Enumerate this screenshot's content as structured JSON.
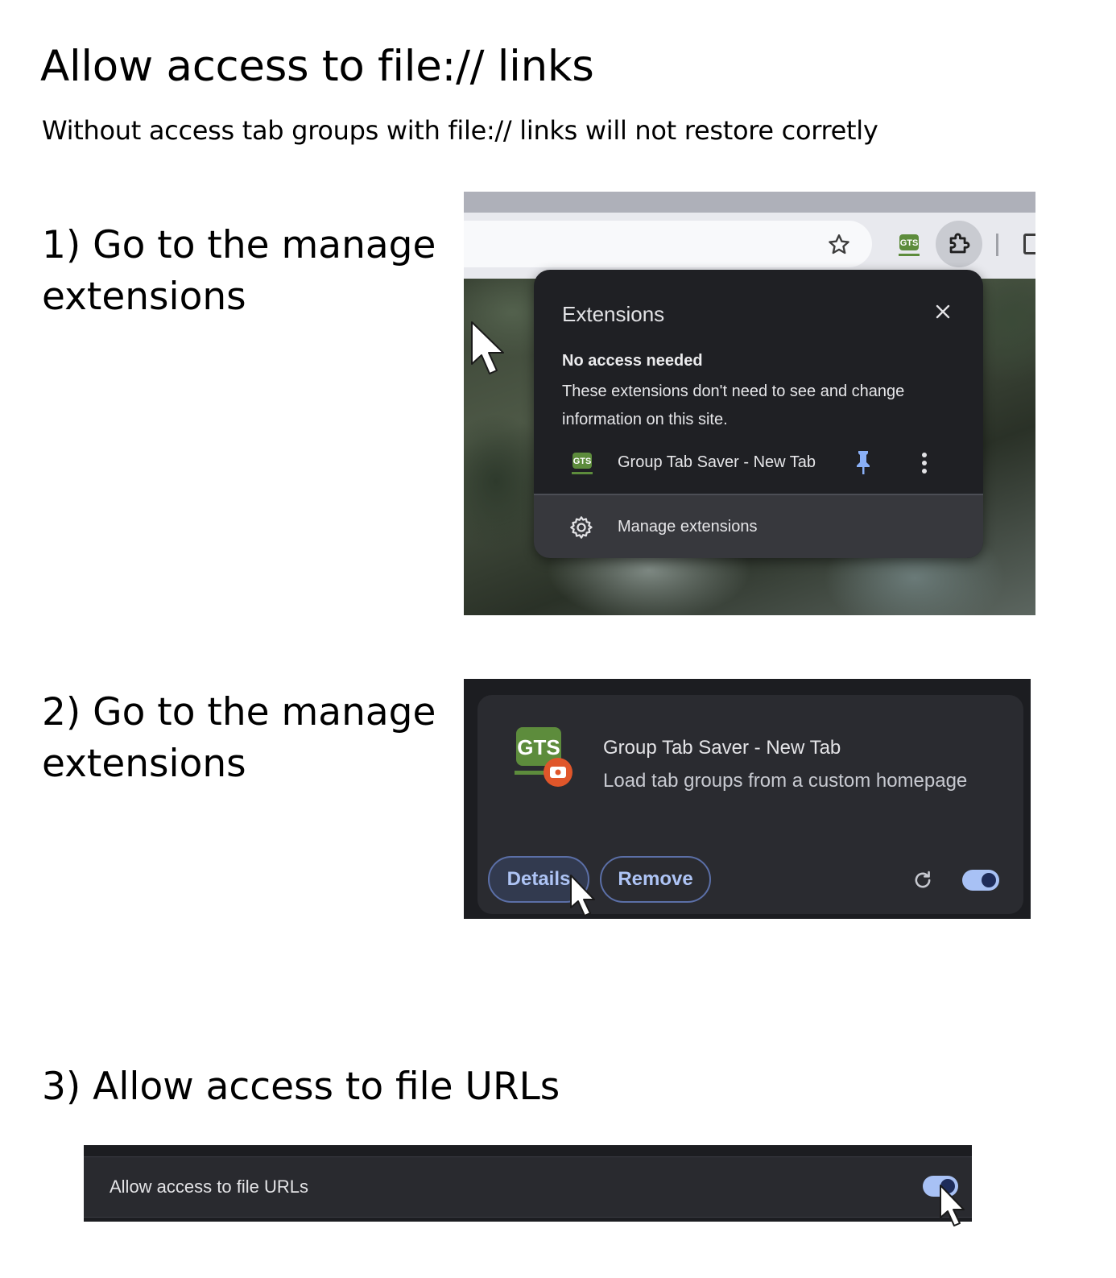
{
  "doc": {
    "title": "Allow access to file:// links",
    "subtitle": "Without access tab groups with file:// links will not restore corretly"
  },
  "steps": [
    {
      "label": "1) Go to the manage extensions"
    },
    {
      "label": "2) Go to the manage extensions"
    },
    {
      "label": "3) Allow access to file URLs"
    }
  ],
  "extensions_popup": {
    "title": "Extensions",
    "section_title": "No access needed",
    "section_description": "These extensions don't need to see and change information on this site.",
    "extension_name": "Group Tab Saver - New Tab",
    "manage_label": "Manage extensions",
    "icons": [
      "star-icon",
      "gts-extension-icon",
      "puzzle-icon",
      "close-icon",
      "pin-icon",
      "more-vert-icon",
      "gear-icon"
    ]
  },
  "extension_card": {
    "name": "Group Tab Saver - New Tab",
    "description": "Load tab groups from a custom homepage",
    "details_label": "Details",
    "remove_label": "Remove",
    "enabled": true,
    "icons": [
      "gts-logo-icon",
      "reload-icon"
    ]
  },
  "file_urls_setting": {
    "label": "Allow access to file URLs",
    "enabled": true
  },
  "colors": {
    "popup_bg": "#1f2024",
    "card_bg": "#2a2b30",
    "accent_blue": "#a8c1f5",
    "button_border": "#5b6fa7",
    "gts_green": "#5d8c3c",
    "gts_badge_orange": "#e0562a"
  }
}
